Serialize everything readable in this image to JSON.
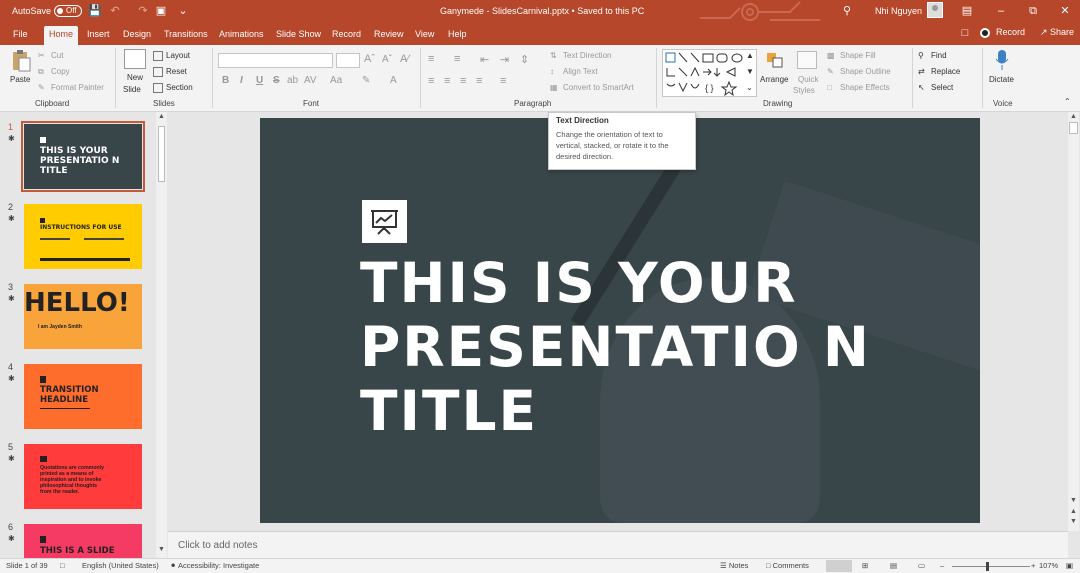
{
  "titlebar": {
    "autosave_label": "AutoSave",
    "autosave_state": "Off",
    "doc_title": "Ganymede - SlidesCarnival.pptx • Saved to this PC",
    "user_name": "Nhi Nguyen"
  },
  "tabs": [
    "File",
    "Home",
    "Insert",
    "Design",
    "Transitions",
    "Animations",
    "Slide Show",
    "Record",
    "Review",
    "View",
    "Help"
  ],
  "active_tab": "Home",
  "tabbar_right": {
    "record": "Record",
    "share": "Share"
  },
  "ribbon": {
    "clipboard": {
      "paste": "Paste",
      "cut": "Cut",
      "copy": "Copy",
      "format_painter": "Format Painter",
      "label": "Clipboard"
    },
    "slides": {
      "new_slide": "New",
      "new_slide_2": "Slide",
      "layout": "Layout",
      "reset": "Reset",
      "section": "Section",
      "label": "Slides"
    },
    "font": {
      "label": "Font",
      "bold": "B",
      "italic": "I",
      "underline": "U",
      "strike": "S",
      "shadow": "ab",
      "spacing": "AV",
      "case": "Aa"
    },
    "paragraph": {
      "text_direction": "Text Direction",
      "align_text": "Align Text",
      "smartart": "Convert to SmartArt",
      "label": "Paragraph"
    },
    "drawing": {
      "arrange": "Arrange",
      "quick_styles": "Quick",
      "quick_styles_2": "Styles",
      "shape_fill": "Shape Fill",
      "shape_outline": "Shape Outline",
      "shape_effects": "Shape Effects",
      "label": "Drawing"
    },
    "editing": {
      "find": "Find",
      "replace": "Replace",
      "select": "Select"
    },
    "voice": {
      "dictate": "Dictate",
      "label": "Voice"
    }
  },
  "tooltip": {
    "title": "Text Direction",
    "body": "Change the orientation of text to vertical, stacked, or rotate it to the desired direction."
  },
  "thumbnails": [
    {
      "num": "1",
      "title": "THIS IS YOUR PRESENTATIO N TITLE",
      "bg": "#384549",
      "fg": "#ffffff"
    },
    {
      "num": "2",
      "title": "INSTRUCTIONS FOR USE",
      "bg": "#ffcc00",
      "fg": "#222222"
    },
    {
      "num": "3",
      "title": "HELLO!",
      "sub": "I am Jayden Smith",
      "bg": "#f9a43a",
      "fg": "#222222"
    },
    {
      "num": "4",
      "title": "TRANSITION HEADLINE",
      "bg": "#ff6d2d",
      "fg": "#222222"
    },
    {
      "num": "5",
      "title": "Quotations are commonly printed as a means of inspiration and to invoke philosophical thoughts from the reader.",
      "bg": "#ff3b3b",
      "fg": "#222222"
    },
    {
      "num": "6",
      "title": "THIS IS A SLIDE",
      "bg": "#f53b63",
      "fg": "#222222"
    }
  ],
  "slide": {
    "title": "THIS IS YOUR PRESENTATIO N TITLE"
  },
  "notes_placeholder": "Click to add notes",
  "status": {
    "slide_count": "Slide 1 of 39",
    "language": "English (United States)",
    "accessibility": "Accessibility: Investigate",
    "notes": "Notes",
    "comments": "Comments",
    "zoom": "107%"
  }
}
